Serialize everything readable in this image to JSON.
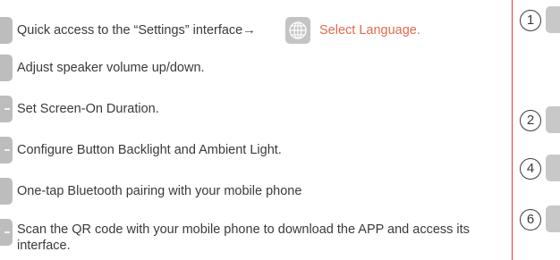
{
  "items": [
    {
      "text": "Quick access to the “Settings” interface→",
      "accent_text": "Select Language.",
      "icon": "settings-icon"
    },
    {
      "text": "Adjust speaker volume up/down.",
      "icon": "volume-icon"
    },
    {
      "text": "Set Screen-On Duration.",
      "icon": "screen-timer-icon"
    },
    {
      "text": "Configure Button Backlight and Ambient Light.",
      "icon": "light-icon"
    },
    {
      "text": "One-tap Bluetooth pairing with your mobile phone",
      "icon": "bluetooth-icon"
    },
    {
      "text": "Scan the QR code with your mobile phone to download the APP and access its interface.",
      "icon": "qr-code-icon"
    }
  ],
  "language_icon": "globe-icon",
  "right_column": {
    "numbers": [
      "1",
      "2",
      "4",
      "6"
    ]
  },
  "colors": {
    "accent": "#e06a4d",
    "divider": "#e33a3a",
    "icon_bg": "#bdbdbd",
    "text": "#3a3a3a"
  }
}
